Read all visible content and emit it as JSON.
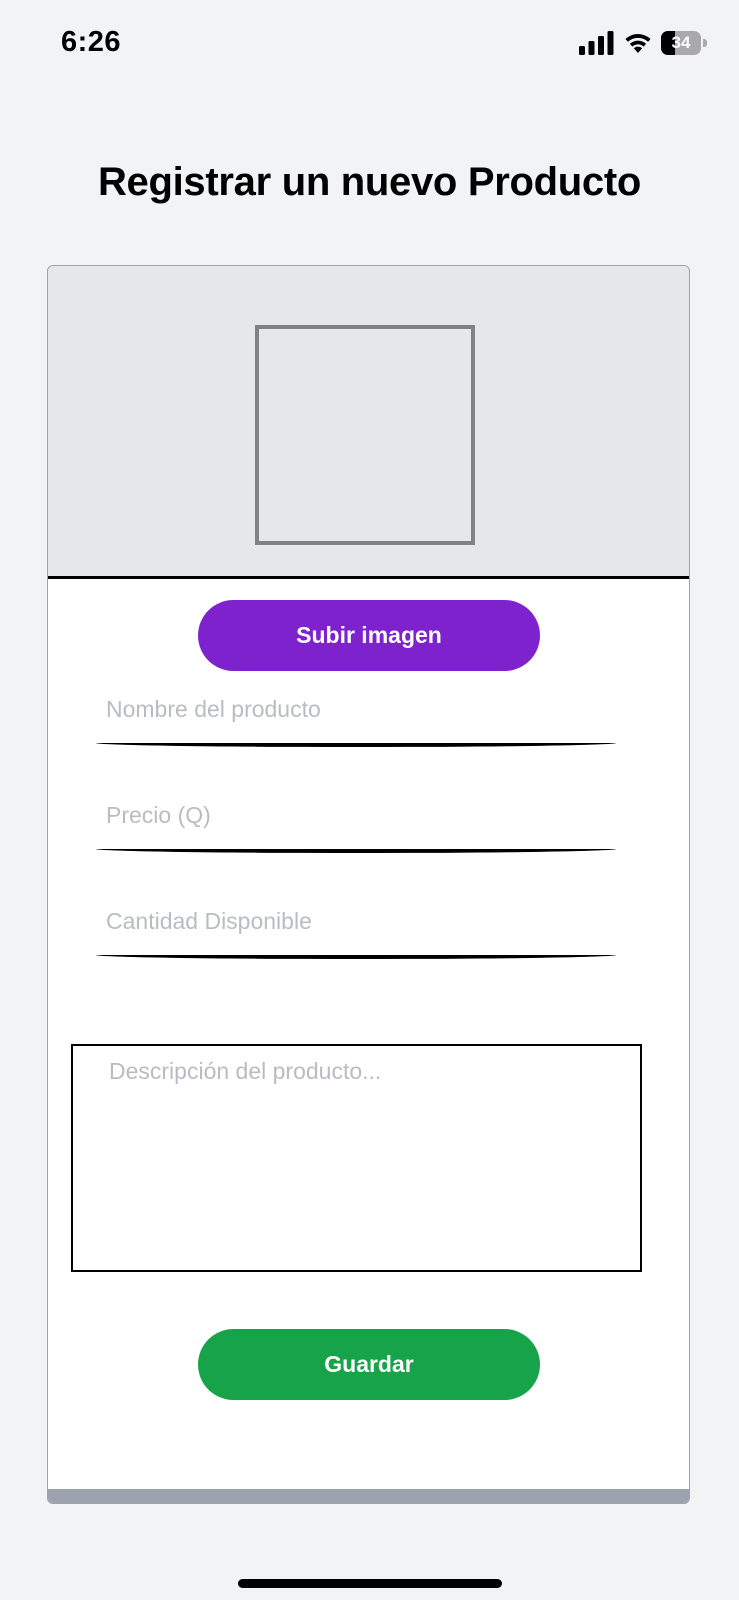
{
  "status_bar": {
    "time": "6:26",
    "battery_level": "34",
    "battery_fraction": 0.34,
    "icons": [
      "signal-icon",
      "wifi-icon",
      "battery-icon"
    ]
  },
  "page": {
    "title": "Registrar un nuevo Producto"
  },
  "form": {
    "upload_label": "Subir imagen",
    "name_placeholder": "Nombre del producto",
    "price_placeholder": "Precio (Q)",
    "quantity_placeholder": "Cantidad Disponible",
    "description_placeholder": "Descripción del producto...",
    "save_label": "Guardar"
  },
  "colors": {
    "background": "#f2f3f5",
    "image_area": "#e5e7eb",
    "upload_button": "#7e22ce",
    "save_button": "#16a34a",
    "placeholder_text": "#b9bcc1",
    "card_footer": "#9ca3af"
  }
}
